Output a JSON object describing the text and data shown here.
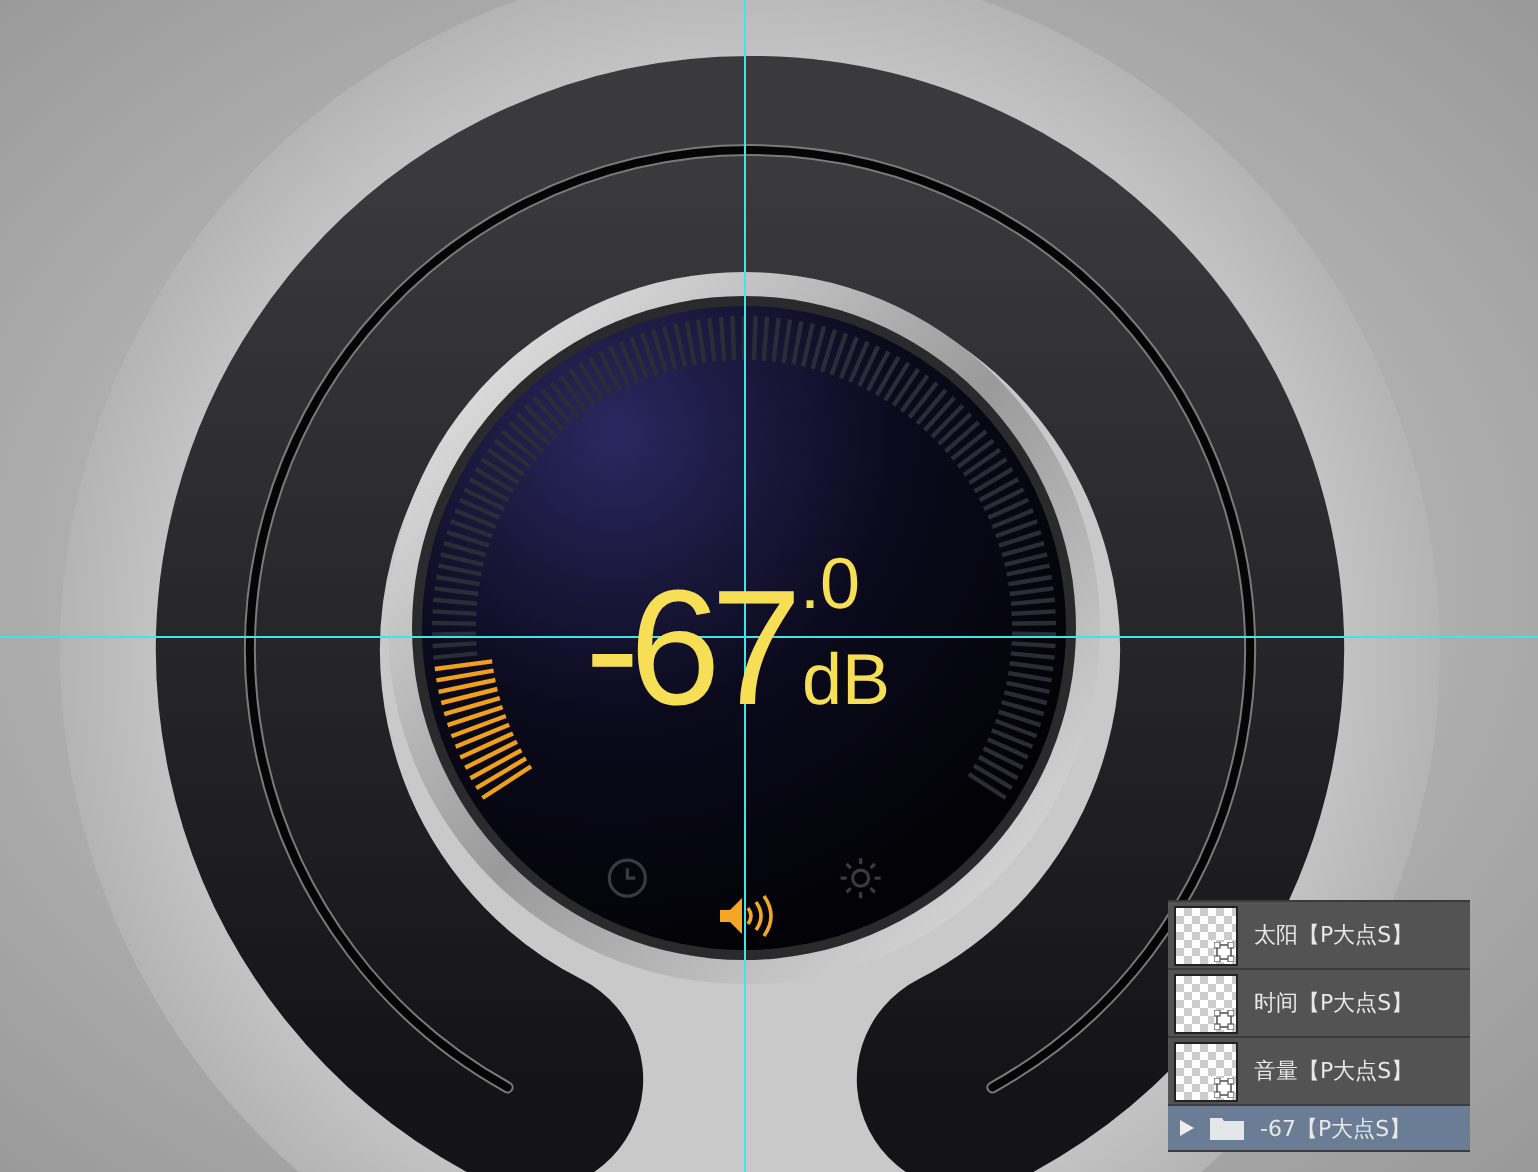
{
  "readout": {
    "value": "-67",
    "decimal": ".0",
    "unit": "dB"
  },
  "volume": {
    "level": 0.11
  },
  "modes": [
    {
      "kind": "clock",
      "selected": false
    },
    {
      "kind": "speaker",
      "selected": true
    },
    {
      "kind": "sun",
      "selected": false
    }
  ],
  "layers": [
    {
      "name": "太阳【P大点S】",
      "kind": "shape",
      "selected": false
    },
    {
      "name": "时间【P大点S】",
      "kind": "shape",
      "selected": false
    },
    {
      "name": "音量【P大点S】",
      "kind": "shape",
      "selected": false
    },
    {
      "name": "-67【P大点S】",
      "kind": "group",
      "selected": true,
      "expanded": false
    }
  ]
}
